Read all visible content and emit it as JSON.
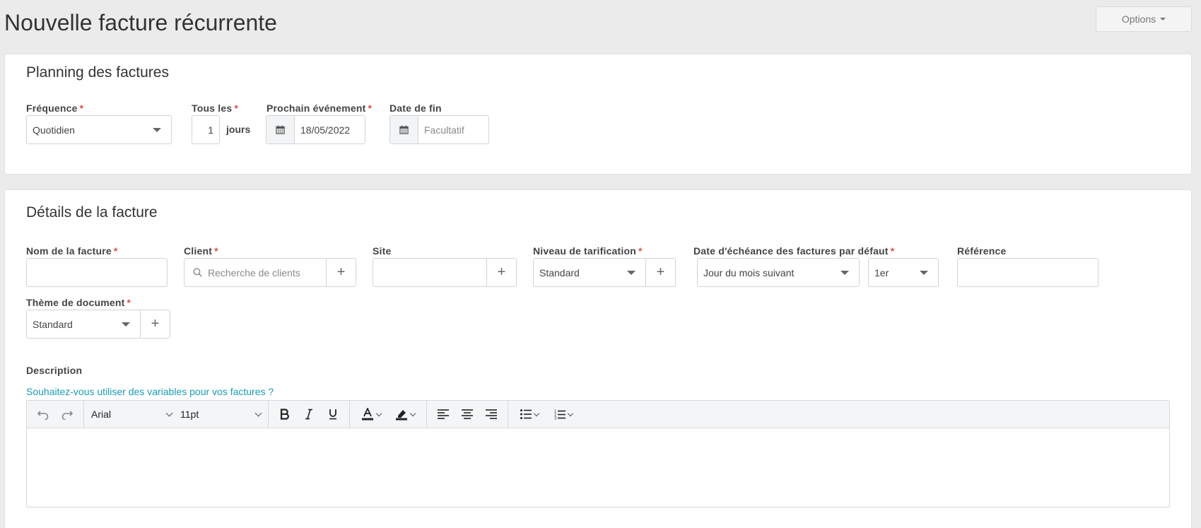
{
  "page": {
    "title": "Nouvelle facture récurrente",
    "options_label": "Options"
  },
  "planning": {
    "title": "Planning des factures",
    "frequency": {
      "label": "Fréquence",
      "required": "*",
      "value": "Quotidien"
    },
    "every": {
      "label": "Tous les",
      "required": "*",
      "value": "1",
      "unit": "jours"
    },
    "next_event": {
      "label": "Prochain événement",
      "required": "*",
      "value": "18/05/2022"
    },
    "end_date": {
      "label": "Date de fin",
      "placeholder": "Facultatif"
    }
  },
  "details": {
    "title": "Détails de la facture",
    "invoice_name": {
      "label": "Nom de la facture",
      "required": "*",
      "value": ""
    },
    "client": {
      "label": "Client",
      "required": "*",
      "placeholder": "Recherche de clients"
    },
    "site": {
      "label": "Site",
      "value": ""
    },
    "pricing_level": {
      "label": "Niveau de tarification",
      "required": "*",
      "value": "Standard"
    },
    "due_date": {
      "label": "Date d'échéance des factures par défaut",
      "required": "*",
      "value": "Jour du mois suivant",
      "day": "1er"
    },
    "reference": {
      "label": "Référence",
      "value": ""
    },
    "doc_theme": {
      "label": "Thème de document",
      "required": "*",
      "value": "Standard"
    },
    "description": {
      "label": "Description",
      "variables_link": "Souhaitez-vous utiliser des variables pour vos factures ?"
    }
  },
  "editor": {
    "font": "Arial",
    "size": "11pt",
    "icons": [
      "undo-icon",
      "redo-icon",
      "bold-icon",
      "italic-icon",
      "underline-icon",
      "text-color-icon",
      "highlight-icon",
      "align-left-icon",
      "align-center-icon",
      "align-right-icon",
      "bullet-list-icon",
      "numbered-list-icon"
    ]
  },
  "colors": {
    "accent_link": "#1a9bb5",
    "required": "#d9534f",
    "background": "#ebebeb"
  }
}
